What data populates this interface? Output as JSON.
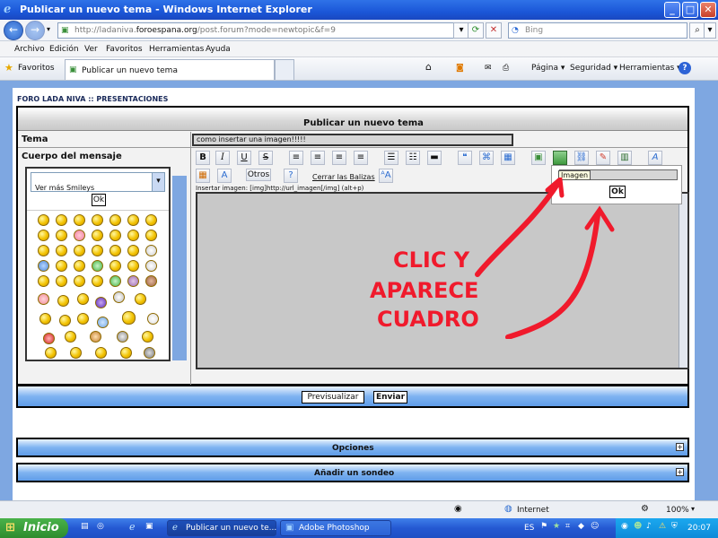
{
  "window": {
    "title": "Publicar un nuevo tema - Windows Internet Explorer",
    "minimize": "_",
    "maximize": "□",
    "close": "✕"
  },
  "address": {
    "url_prefix": "http://ladaniva.",
    "url_domain": "foroespana.org",
    "url_suffix": "/post.forum?mode=newtopic&f=9",
    "search_placeholder": "Bing"
  },
  "menu": [
    "Archivo",
    "Edición",
    "Ver",
    "Favoritos",
    "Herramientas",
    "Ayuda"
  ],
  "favorites": {
    "label": "Favoritos",
    "tab_title": "Publicar un nuevo tema",
    "commands": [
      "Página ▾",
      "Seguridad ▾",
      "Herramientas ▾"
    ]
  },
  "forum": {
    "breadcrumb": "FORO LADA NIVA :: PRESENTACIONES",
    "header": "Publicar un nuevo tema",
    "topic_label": "Tema",
    "topic_value": "como insertar una imagen!!!!!",
    "body_label": "Cuerpo del mensaje",
    "smileys_select": "Ver más Smileys",
    "ok": "Ok",
    "otros": "Otros",
    "close_tags": "Cerrar las Balizas",
    "hint": "Insertar imagen: [img]http://url_imagen[/img] (alt+p)",
    "image_tooltip": "Imagen",
    "popup_ok": "Ok",
    "preview_button": "Previsualizar",
    "send_button": "Enviar",
    "options_label": "Opciones",
    "poll_label": "Añadir un sondeo"
  },
  "annotation": {
    "line1": "CLIC Y",
    "line2": "APARECE",
    "line3": "CUADRO",
    "color": "#f01a2c"
  },
  "status": {
    "zone": "Internet",
    "zoom": "100%"
  },
  "taskbar": {
    "start": "Inicio",
    "task1": "Publicar un nuevo te...",
    "task2": "Adobe Photoshop",
    "lang": "ES",
    "clock": "20:07"
  },
  "colors": {
    "title_blue": "#1b57d8",
    "page_blue": "#7ea7e1",
    "start_green": "#2e8c2e"
  }
}
